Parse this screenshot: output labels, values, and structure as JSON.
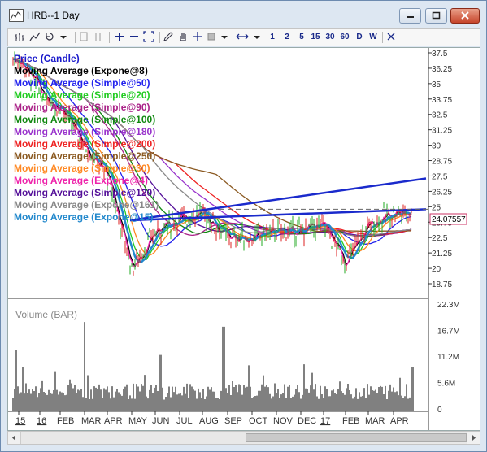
{
  "window": {
    "title": "HRB--1 Day"
  },
  "toolbar": {
    "periods": [
      "1",
      "2",
      "5",
      "15",
      "30",
      "60",
      "D",
      "W"
    ]
  },
  "price_panel": {
    "legend": [
      {
        "label": "Price (Candle)",
        "color": "#1a1acc"
      },
      {
        "label": "Moving Average (Expone@8)",
        "color": "#000000"
      },
      {
        "label": "Moving Average (Simple@50)",
        "color": "#2222ee"
      },
      {
        "label": "Moving Average (Simple@20)",
        "color": "#22cc22"
      },
      {
        "label": "Moving Average (Simple@90)",
        "color": "#aa2288"
      },
      {
        "label": "Moving Average (Simple@100)",
        "color": "#118811"
      },
      {
        "label": "Moving Average (Simple@180)",
        "color": "#9933cc"
      },
      {
        "label": "Moving Average (Simple@200)",
        "color": "#ee2222"
      },
      {
        "label": "Moving Average (Simple@250)",
        "color": "#8b5a22"
      },
      {
        "label": "Moving Average (Simple@30)",
        "color": "#ff8822"
      },
      {
        "label": "Moving Average (Expone@4)",
        "color": "#ee22aa"
      },
      {
        "label": "Moving Average (Simple@120)",
        "color": "#551199"
      },
      {
        "label": "Moving Average (Expone@161)",
        "color": "#888888"
      },
      {
        "label": "Moving Average (Expone@15)",
        "color": "#2288cc"
      }
    ],
    "price_axis_ticks": [
      "37.5",
      "36.25",
      "35",
      "33.75",
      "32.5",
      "31.25",
      "30",
      "28.75",
      "27.5",
      "26.25",
      "25",
      "23.75",
      "22.5",
      "21.25",
      "20",
      "18.75"
    ],
    "last_price": "24.07557"
  },
  "volume_panel": {
    "label": "Volume (BAR)",
    "axis_ticks": [
      "22.3M",
      "16.7M",
      "11.2M",
      "5.6M",
      "0"
    ]
  },
  "x_axis": {
    "labels": [
      "15",
      "16",
      "FEB",
      "MAR",
      "APR",
      "MAY",
      "JUN",
      "JUL",
      "AUG",
      "SEP",
      "OCT",
      "NOV",
      "DEC",
      "17",
      "FEB",
      "MAR",
      "APR"
    ]
  },
  "chart_data": {
    "type": "line",
    "title": "HRB--1 Day",
    "x": [
      "15",
      "16",
      "FEB",
      "MAR",
      "APR",
      "MAY",
      "JUN",
      "JUL",
      "AUG",
      "SEP",
      "OCT",
      "NOV",
      "DEC",
      "17",
      "FEB",
      "MAR",
      "APR"
    ],
    "ylim": [
      18.75,
      37.5
    ],
    "series": [
      {
        "name": "Price (Candle)",
        "values": [
          37.0,
          34.5,
          33.0,
          30.0,
          27.5,
          20.0,
          23.0,
          24.0,
          24.5,
          22.5,
          22.5,
          23.0,
          23.0,
          23.5,
          20.5,
          23.5,
          24.5
        ]
      }
    ],
    "volume": {
      "ylim": [
        0,
        22.3
      ],
      "unit": "M"
    }
  }
}
